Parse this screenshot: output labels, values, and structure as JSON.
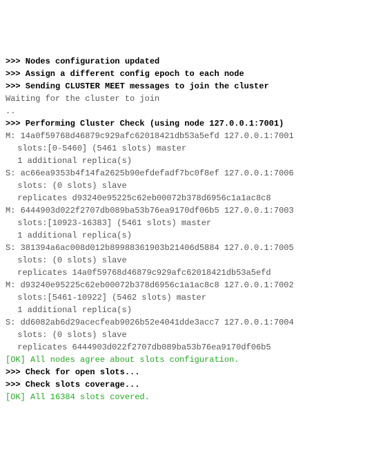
{
  "lines": [
    {
      "style": "bold",
      "indent": 0,
      "text": ">>> Nodes configuration updated"
    },
    {
      "style": "bold",
      "indent": 0,
      "text": ">>> Assign a different config epoch to each node"
    },
    {
      "style": "bold",
      "indent": 0,
      "text": ">>> Sending CLUSTER MEET messages to join the cluster"
    },
    {
      "style": "",
      "indent": 0,
      "text": "Waiting for the cluster to join"
    },
    {
      "style": "",
      "indent": 0,
      "text": ".."
    },
    {
      "style": "bold",
      "indent": 0,
      "text": ">>> Performing Cluster Check (using node 127.0.0.1:7001)"
    },
    {
      "style": "",
      "indent": 0,
      "text": "M: 14a0f59768d46879c929afc62018421db53a5efd 127.0.0.1:7001"
    },
    {
      "style": "",
      "indent": 1,
      "text": "slots:[0-5460] (5461 slots) master"
    },
    {
      "style": "",
      "indent": 1,
      "text": "1 additional replica(s)"
    },
    {
      "style": "",
      "indent": 0,
      "text": "S: ac66ea9353b4f14fa2625b90efdefadf7bc0f8ef 127.0.0.1:7006"
    },
    {
      "style": "",
      "indent": 1,
      "text": "slots: (0 slots) slave"
    },
    {
      "style": "",
      "indent": 1,
      "text": "replicates d93240e95225c62eb00072b378d6956c1a1ac8c8"
    },
    {
      "style": "",
      "indent": 0,
      "text": "M: 6444903d022f2707db089ba53b76ea9170df06b5 127.0.0.1:7003"
    },
    {
      "style": "",
      "indent": 1,
      "text": "slots:[10923-16383] (5461 slots) master"
    },
    {
      "style": "",
      "indent": 1,
      "text": "1 additional replica(s)"
    },
    {
      "style": "",
      "indent": 0,
      "text": "S: 381394a6ac008d012b89988361903b21406d5884 127.0.0.1:7005"
    },
    {
      "style": "",
      "indent": 1,
      "text": "slots: (0 slots) slave"
    },
    {
      "style": "",
      "indent": 1,
      "text": "replicates 14a0f59768d46879c929afc62018421db53a5efd"
    },
    {
      "style": "",
      "indent": 0,
      "text": "M: d93240e95225c62eb00072b378d6956c1a1ac8c8 127.0.0.1:7002"
    },
    {
      "style": "",
      "indent": 1,
      "text": "slots:[5461-10922] (5462 slots) master"
    },
    {
      "style": "",
      "indent": 1,
      "text": "1 additional replica(s)"
    },
    {
      "style": "",
      "indent": 0,
      "text": "S: dd6082ab6d29acecfeab9026b52e4041dde3acc7 127.0.0.1:7004"
    },
    {
      "style": "",
      "indent": 1,
      "text": "slots: (0 slots) slave"
    },
    {
      "style": "",
      "indent": 1,
      "text": "replicates 6444903d022f2707db089ba53b76ea9170df06b5"
    },
    {
      "style": "green",
      "indent": 0,
      "text": "[OK] All nodes agree about slots configuration."
    },
    {
      "style": "bold",
      "indent": 0,
      "text": ">>> Check for open slots..."
    },
    {
      "style": "bold",
      "indent": 0,
      "text": ">>> Check slots coverage..."
    },
    {
      "style": "green",
      "indent": 0,
      "text": "[OK] All 16384 slots covered."
    }
  ]
}
